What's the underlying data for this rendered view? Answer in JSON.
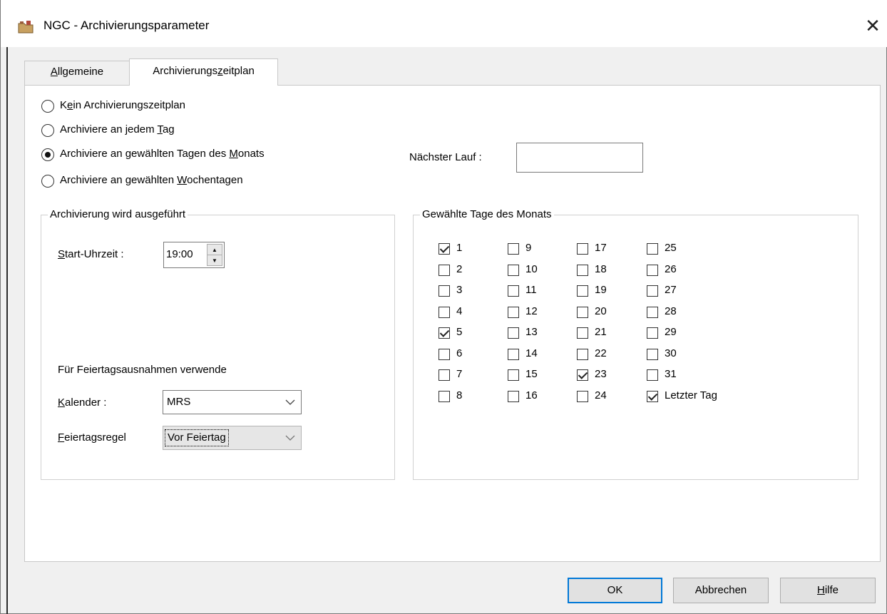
{
  "window": {
    "title": "NGC - Archivierungsparameter",
    "app_icon": "folder-icon",
    "close_glyph": "✕"
  },
  "tabs": [
    {
      "label_pre": "",
      "label_u": "A",
      "label_post": "llgemeine",
      "active": false
    },
    {
      "label_pre": "Archivierungs",
      "label_u": "z",
      "label_post": "eitplan",
      "active": true
    }
  ],
  "schedule": {
    "options": [
      {
        "pre": "K",
        "u": "e",
        "post": "in Archivierungszeitplan",
        "selected": false
      },
      {
        "pre": "Archiviere an jedem ",
        "u": "T",
        "post": "ag",
        "selected": false
      },
      {
        "pre": "Archiviere an gewählten Tagen des ",
        "u": "M",
        "post": "onats",
        "selected": true
      },
      {
        "pre": "Archiviere an gewählten ",
        "u": "W",
        "post": "ochentagen",
        "selected": false
      }
    ],
    "next_run_label": "Nächster Lauf :",
    "next_run_value": ""
  },
  "execution": {
    "group_title": "Archivierung wird ausgeführt",
    "start_label_u": "S",
    "start_label_post": "tart-Uhrzeit :",
    "start_time": "19:00",
    "holiday_heading": "Für Feiertagsausnahmen verwende",
    "calendar_label_u": "K",
    "calendar_label_post": "alender :",
    "calendar_value": "MRS",
    "rule_label_u": "F",
    "rule_label_post": "eiertagsregel",
    "rule_value": "Vor Feiertag"
  },
  "days": {
    "group_title": "Gewählte Tage des Monats",
    "columns": [
      [
        {
          "label": "1",
          "checked": true
        },
        {
          "label": "2",
          "checked": false
        },
        {
          "label": "3",
          "checked": false
        },
        {
          "label": "4",
          "checked": false
        },
        {
          "label": "5",
          "checked": true
        },
        {
          "label": "6",
          "checked": false
        },
        {
          "label": "7",
          "checked": false
        },
        {
          "label": "8",
          "checked": false
        }
      ],
      [
        {
          "label": "9",
          "checked": false
        },
        {
          "label": "10",
          "checked": false
        },
        {
          "label": "11",
          "checked": false
        },
        {
          "label": "12",
          "checked": false
        },
        {
          "label": "13",
          "checked": false
        },
        {
          "label": "14",
          "checked": false
        },
        {
          "label": "15",
          "checked": false
        },
        {
          "label": "16",
          "checked": false
        }
      ],
      [
        {
          "label": "17",
          "checked": false
        },
        {
          "label": "18",
          "checked": false
        },
        {
          "label": "19",
          "checked": false
        },
        {
          "label": "20",
          "checked": false
        },
        {
          "label": "21",
          "checked": false
        },
        {
          "label": "22",
          "checked": false
        },
        {
          "label": "23",
          "checked": true
        },
        {
          "label": "24",
          "checked": false
        }
      ],
      [
        {
          "label": "25",
          "checked": false
        },
        {
          "label": "26",
          "checked": false
        },
        {
          "label": "27",
          "checked": false
        },
        {
          "label": "28",
          "checked": false
        },
        {
          "label": "29",
          "checked": false
        },
        {
          "label": "30",
          "checked": false
        },
        {
          "label": "31",
          "checked": false
        },
        {
          "label": "Letzter Tag",
          "checked": true
        }
      ]
    ]
  },
  "buttons": {
    "ok": "OK",
    "cancel": "Abbrechen",
    "help_u": "H",
    "help_post": "ilfe"
  }
}
